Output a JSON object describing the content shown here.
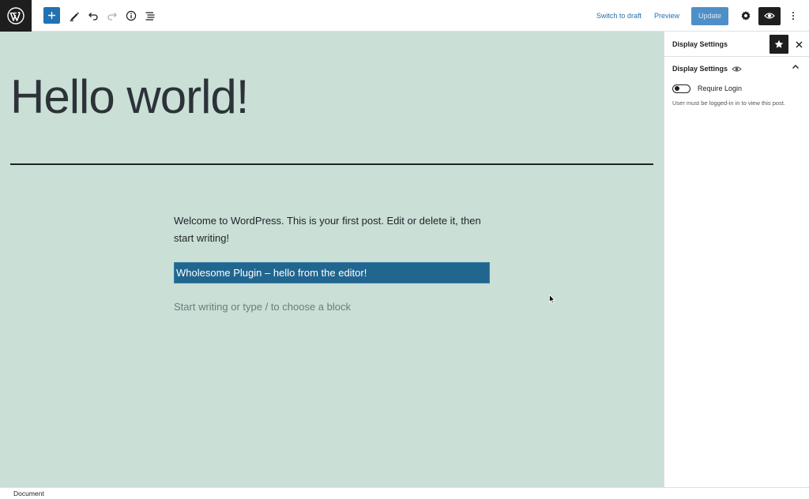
{
  "toolbar": {
    "logo_icon": "wordpress-logo-icon",
    "tools": [
      {
        "name": "inserter",
        "icon": "plus-icon"
      },
      {
        "name": "tools",
        "icon": "pencil-icon"
      },
      {
        "name": "undo",
        "icon": "undo-icon"
      },
      {
        "name": "redo",
        "icon": "redo-icon"
      },
      {
        "name": "details",
        "icon": "info-icon"
      },
      {
        "name": "list-view",
        "icon": "list-view-icon"
      }
    ],
    "switch_to_draft": "Switch to draft",
    "preview": "Preview",
    "update": "Update",
    "accent": "#2271b1"
  },
  "editor": {
    "title": "Hello world!",
    "paragraph": "Welcome to WordPress. This is your first post. Edit or delete it, then start writing!",
    "selected_block_text": "Wholesome Plugin – hello from the editor!",
    "placeholder": "Start writing or type / to choose a block",
    "background": "#cadfd6"
  },
  "sidebar": {
    "header_title": "Display Settings",
    "panel_title": "Display Settings",
    "toggle_label": "Require Login",
    "toggle_on": false,
    "help_text": "User must be logged-in in to view this post."
  },
  "footer": {
    "breadcrumb": "Document"
  }
}
